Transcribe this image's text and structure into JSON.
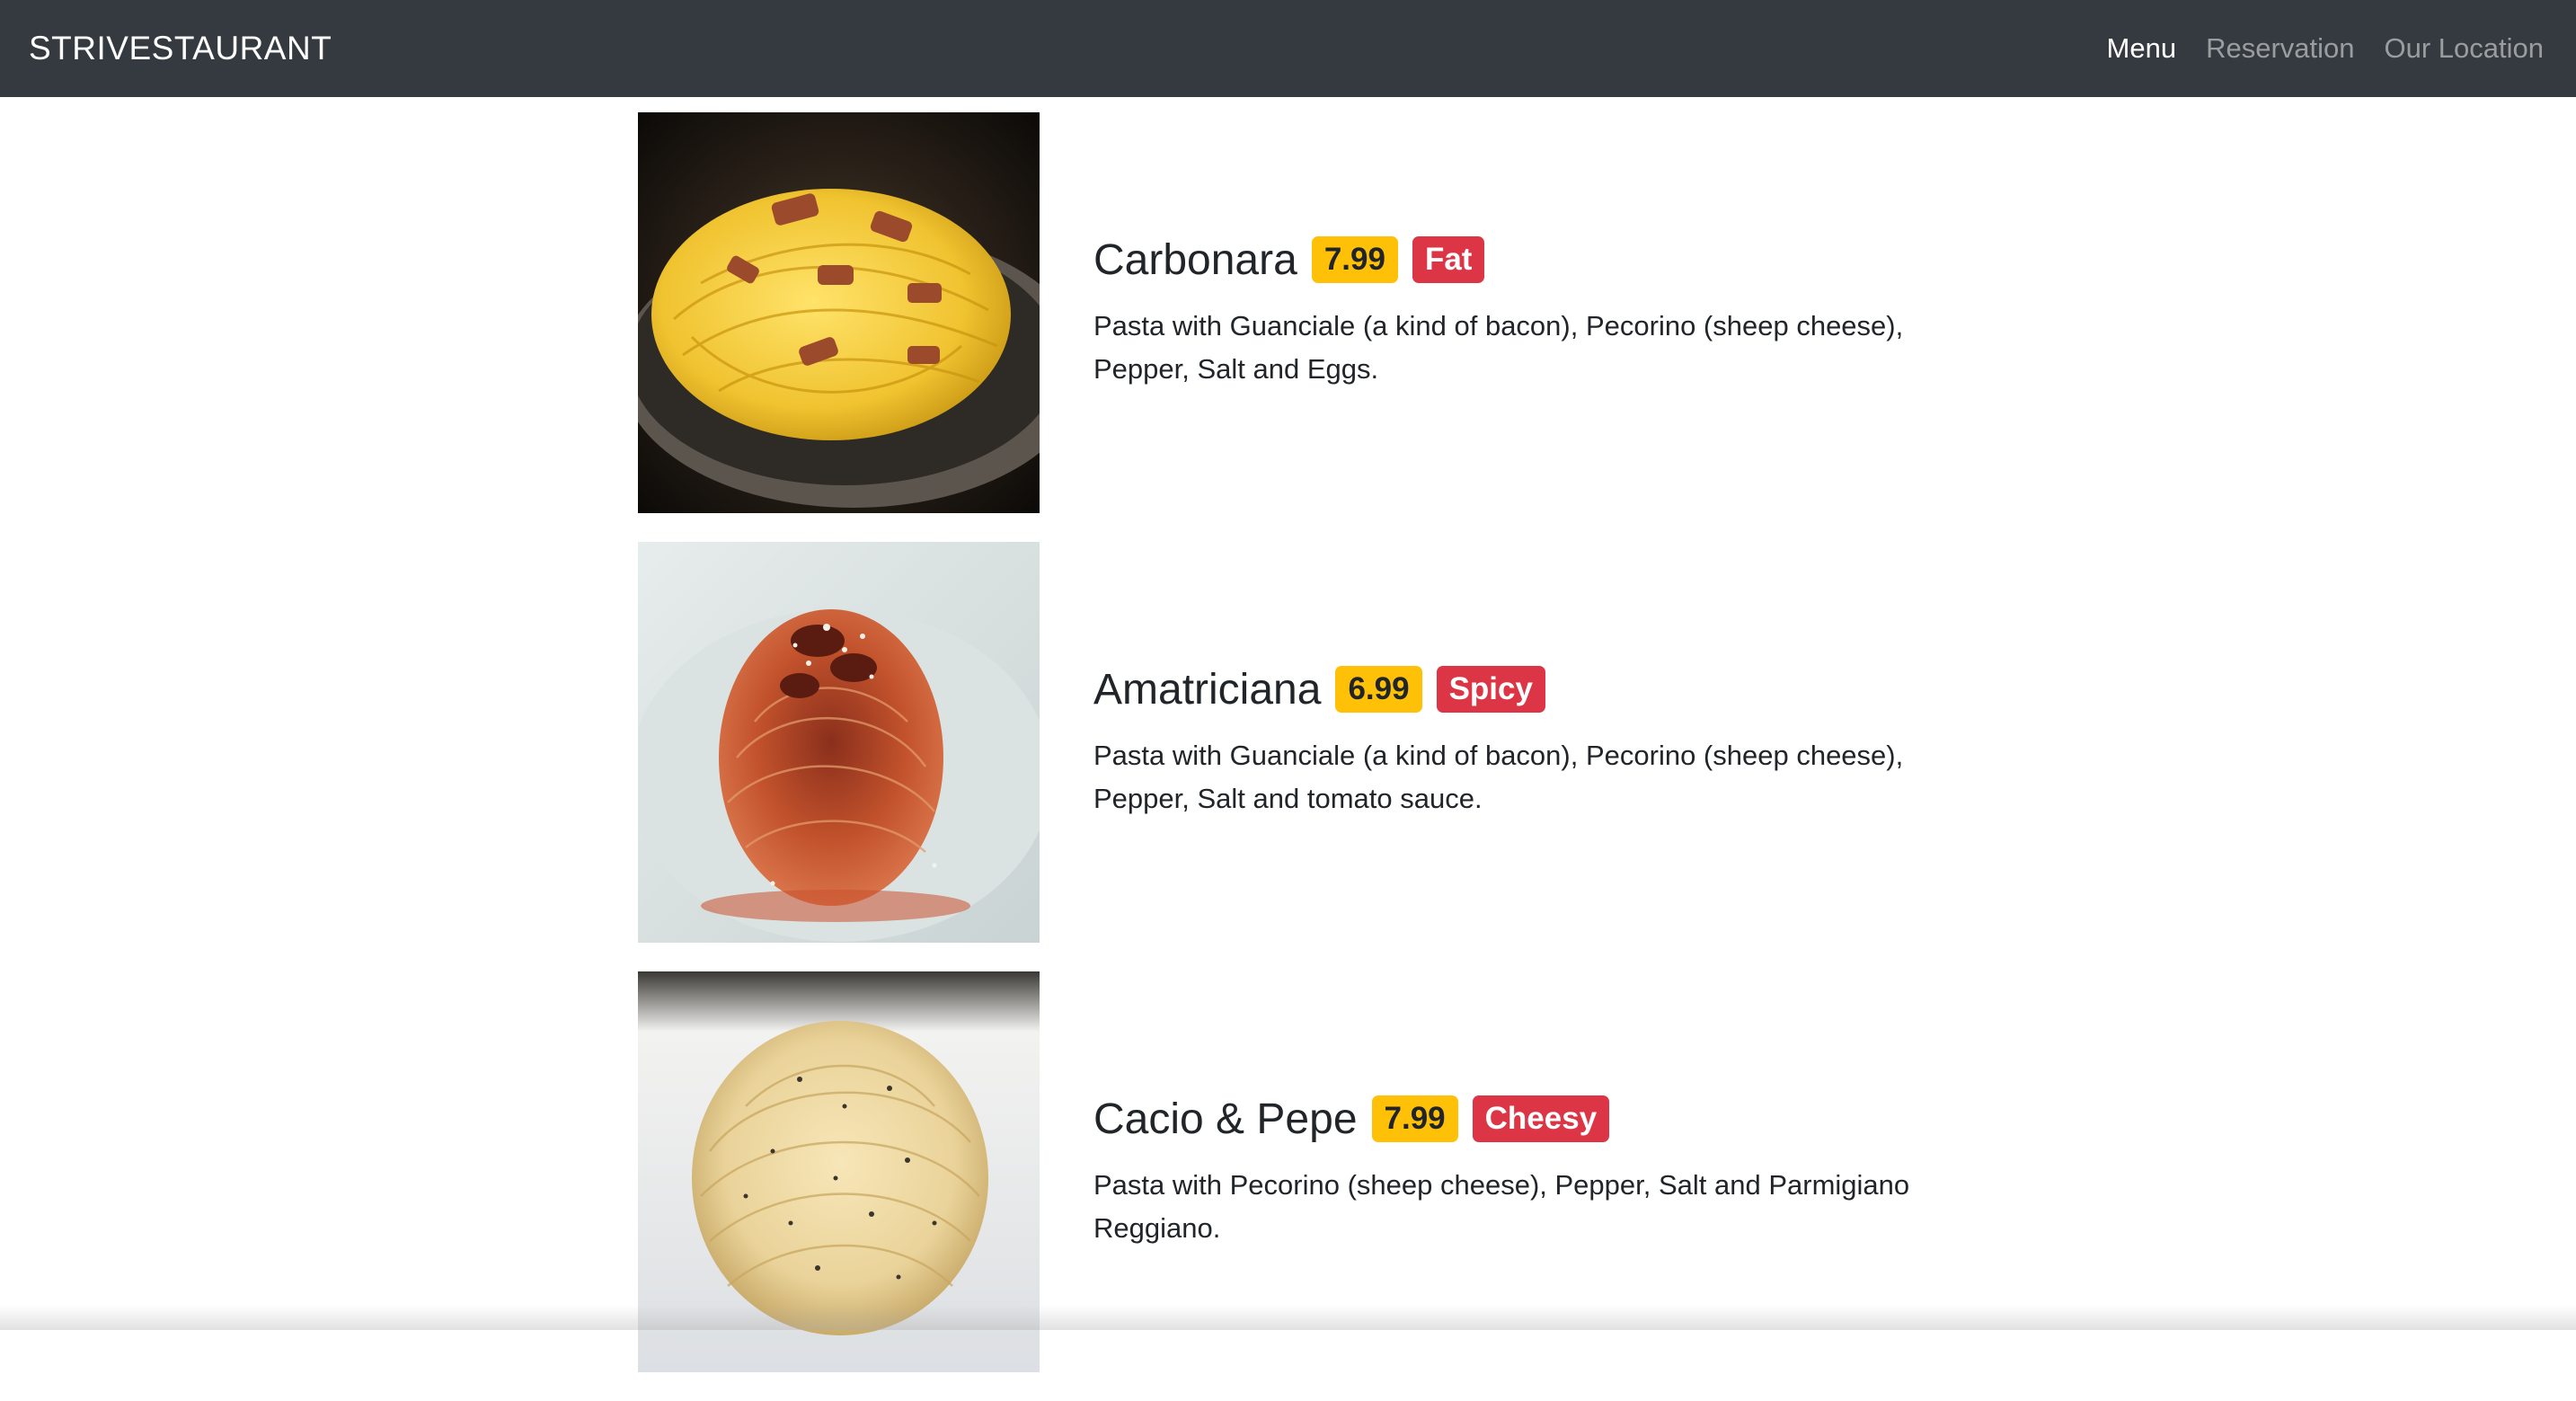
{
  "navbar": {
    "brand": "STRIVESTAURANT",
    "links": [
      {
        "label": "Menu",
        "active": true
      },
      {
        "label": "Reservation",
        "active": false
      },
      {
        "label": "Our Location",
        "active": false
      }
    ]
  },
  "menu": {
    "items": [
      {
        "name": "Carbonara",
        "price": "7.99",
        "tag": "Fat",
        "description": "Pasta with Guanciale (a kind of bacon), Pecorino (sheep cheese), Pepper, Salt and Eggs."
      },
      {
        "name": "Amatriciana",
        "price": "6.99",
        "tag": "Spicy",
        "description": "Pasta with Guanciale (a kind of bacon), Pecorino (sheep cheese), Pepper, Salt and tomato sauce."
      },
      {
        "name": "Cacio & Pepe",
        "price": "7.99",
        "tag": "Cheesy",
        "description": "Pasta with Pecorino (sheep cheese), Pepper, Salt and Parmigiano Reggiano."
      }
    ]
  },
  "colors": {
    "navbar_bg": "#343a40",
    "price_badge": "#ffc107",
    "tag_badge": "#dc3545"
  }
}
